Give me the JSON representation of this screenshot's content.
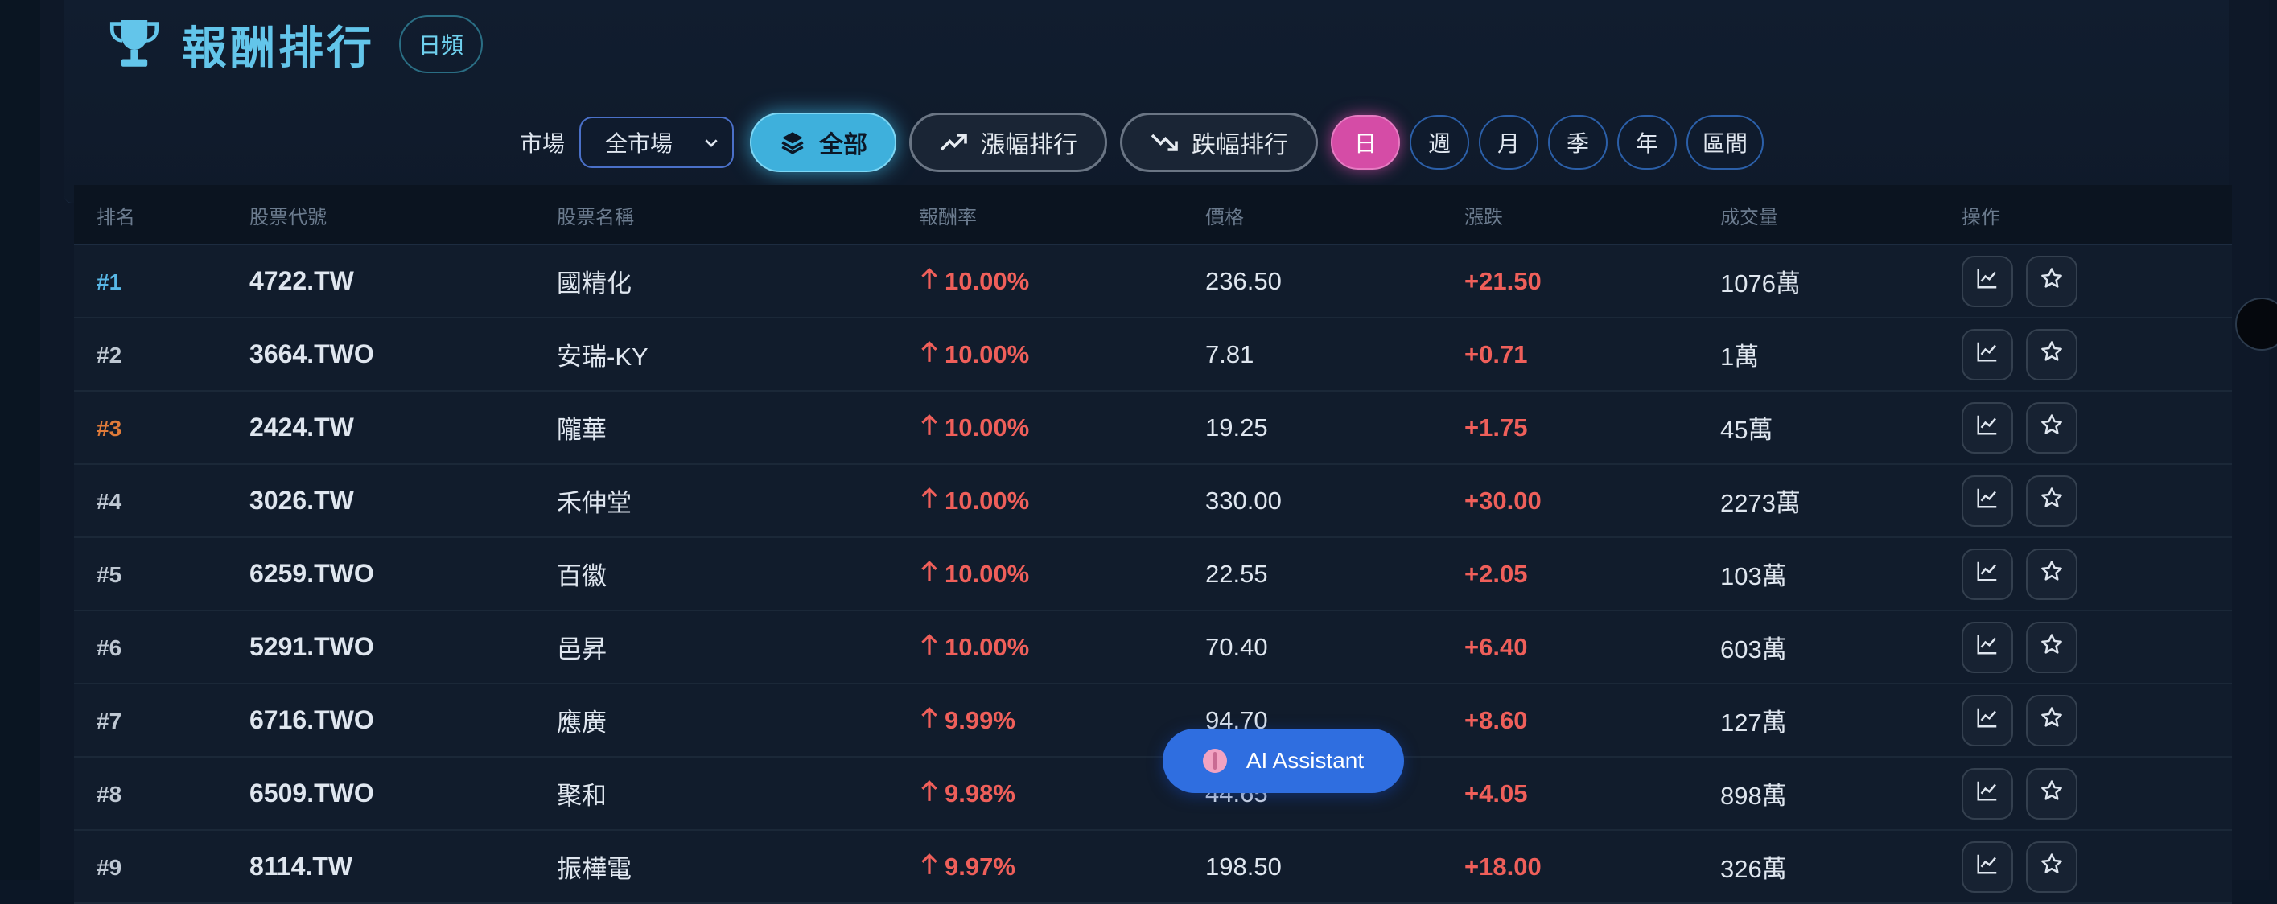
{
  "header": {
    "title": "報酬排行",
    "frequency_badge": "日頻"
  },
  "controls": {
    "market_label": "市場",
    "market_value": "全市場",
    "filters": [
      {
        "label": "全部",
        "icon": "layers-icon"
      },
      {
        "label": "漲幅排行",
        "icon": "trending-up-icon"
      },
      {
        "label": "跌幅排行",
        "icon": "trending-down-icon"
      }
    ],
    "periods": [
      "日",
      "週",
      "月",
      "季",
      "年",
      "區間"
    ],
    "active_period": "日"
  },
  "table": {
    "columns": [
      "排名",
      "股票代號",
      "股票名稱",
      "報酬率",
      "價格",
      "漲跌",
      "成交量",
      "操作"
    ],
    "rows": [
      {
        "rank": "#1",
        "code": "4722.TW",
        "name": "國精化",
        "return": "10.00%",
        "price": "236.50",
        "change": "+21.50",
        "volume": "1076萬"
      },
      {
        "rank": "#2",
        "code": "3664.TWO",
        "name": "安瑞-KY",
        "return": "10.00%",
        "price": "7.81",
        "change": "+0.71",
        "volume": "1萬"
      },
      {
        "rank": "#3",
        "code": "2424.TW",
        "name": "隴華",
        "return": "10.00%",
        "price": "19.25",
        "change": "+1.75",
        "volume": "45萬"
      },
      {
        "rank": "#4",
        "code": "3026.TW",
        "name": "禾伸堂",
        "return": "10.00%",
        "price": "330.00",
        "change": "+30.00",
        "volume": "2273萬"
      },
      {
        "rank": "#5",
        "code": "6259.TWO",
        "name": "百徽",
        "return": "10.00%",
        "price": "22.55",
        "change": "+2.05",
        "volume": "103萬"
      },
      {
        "rank": "#6",
        "code": "5291.TWO",
        "name": "邑昇",
        "return": "10.00%",
        "price": "70.40",
        "change": "+6.40",
        "volume": "603萬"
      },
      {
        "rank": "#7",
        "code": "6716.TWO",
        "name": "應廣",
        "return": "9.99%",
        "price": "94.70",
        "change": "+8.60",
        "volume": "127萬"
      },
      {
        "rank": "#8",
        "code": "6509.TWO",
        "name": "聚和",
        "return": "9.98%",
        "price": "44.65",
        "change": "+4.05",
        "volume": "898萬"
      },
      {
        "rank": "#9",
        "code": "8114.TW",
        "name": "振樺電",
        "return": "9.97%",
        "price": "198.50",
        "change": "+18.00",
        "volume": "326萬"
      }
    ]
  },
  "ai_assistant": {
    "label": "AI Assistant"
  },
  "colors": {
    "accent": "#3eb0dc",
    "positive": "#ef5f5a",
    "period_active": "#d54ca6",
    "rank_first": "#58b7e6",
    "rank_third": "#e07b3a"
  }
}
